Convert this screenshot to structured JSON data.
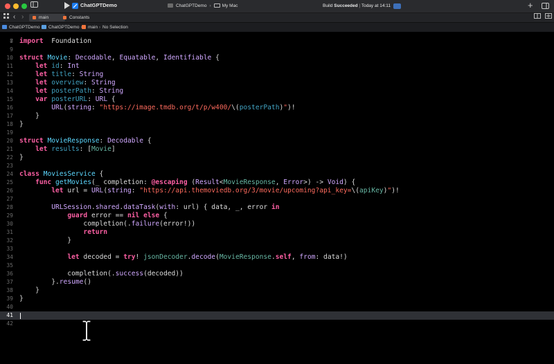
{
  "window": {
    "title": "ChatGPTDemo",
    "scheme": "ChatGPTDemo",
    "destination": "My Mac",
    "status_prefix": "Build",
    "status_bold": "Succeeded",
    "status_time": "Today at 14:11"
  },
  "tabs": [
    "main",
    "Constants"
  ],
  "breadcrumb": [
    "ChatGPTDemo",
    "ChatGPTDemo",
    "main",
    "No Selection"
  ],
  "code": {
    "partial_line_number": "7",
    "current_line": 41,
    "lines": [
      {
        "n": "8",
        "t": [
          [
            "kw",
            "import"
          ],
          [
            "",
            "  Foundation"
          ]
        ]
      },
      {
        "n": "9",
        "t": []
      },
      {
        "n": "10",
        "t": [
          [
            "kw",
            "struct"
          ],
          [
            "",
            " "
          ],
          [
            "ty",
            "Movie"
          ],
          [
            "",
            ": "
          ],
          [
            "lib",
            "Decodable"
          ],
          [
            "",
            ", "
          ],
          [
            "lib",
            "Equatable"
          ],
          [
            "",
            ", "
          ],
          [
            "lib",
            "Identifiable"
          ],
          [
            "",
            " {"
          ]
        ]
      },
      {
        "n": "11",
        "t": [
          [
            "",
            "    "
          ],
          [
            "kw",
            "let"
          ],
          [
            "",
            " "
          ],
          [
            "pr",
            "id"
          ],
          [
            "",
            ": "
          ],
          [
            "lib",
            "Int"
          ]
        ]
      },
      {
        "n": "12",
        "t": [
          [
            "",
            "    "
          ],
          [
            "kw",
            "let"
          ],
          [
            "",
            " "
          ],
          [
            "pr",
            "title"
          ],
          [
            "",
            ": "
          ],
          [
            "lib",
            "String"
          ]
        ]
      },
      {
        "n": "13",
        "t": [
          [
            "",
            "    "
          ],
          [
            "kw",
            "let"
          ],
          [
            "",
            " "
          ],
          [
            "pr",
            "overview"
          ],
          [
            "",
            ": "
          ],
          [
            "lib",
            "String"
          ]
        ]
      },
      {
        "n": "14",
        "t": [
          [
            "",
            "    "
          ],
          [
            "kw",
            "let"
          ],
          [
            "",
            " "
          ],
          [
            "pr",
            "posterPath"
          ],
          [
            "",
            ": "
          ],
          [
            "lib",
            "String"
          ]
        ]
      },
      {
        "n": "15",
        "t": [
          [
            "",
            "    "
          ],
          [
            "kw",
            "var"
          ],
          [
            "",
            " "
          ],
          [
            "pr",
            "posterURL"
          ],
          [
            "",
            ": "
          ],
          [
            "lib",
            "URL"
          ],
          [
            "",
            " {"
          ]
        ]
      },
      {
        "n": "16",
        "t": [
          [
            "",
            "        "
          ],
          [
            "lib",
            "URL"
          ],
          [
            "",
            "("
          ],
          [
            "lib",
            "string"
          ],
          [
            "",
            ": "
          ],
          [
            "st",
            "\"https://image.tmdb.org/t/p/w400/"
          ],
          [
            "",
            "\\("
          ],
          [
            "pr",
            "posterPath"
          ],
          [
            "",
            ")"
          ],
          [
            "st",
            "\""
          ],
          [
            "",
            ")!"
          ]
        ]
      },
      {
        "n": "17",
        "t": [
          [
            "",
            "    }"
          ]
        ]
      },
      {
        "n": "18",
        "t": [
          [
            "",
            "}"
          ]
        ]
      },
      {
        "n": "19",
        "t": []
      },
      {
        "n": "20",
        "t": [
          [
            "kw",
            "struct"
          ],
          [
            "",
            " "
          ],
          [
            "ty",
            "MovieResponse"
          ],
          [
            "",
            ": "
          ],
          [
            "lib",
            "Decodable"
          ],
          [
            "",
            " {"
          ]
        ]
      },
      {
        "n": "21",
        "t": [
          [
            "",
            "    "
          ],
          [
            "kw",
            "let"
          ],
          [
            "",
            " "
          ],
          [
            "pr",
            "results"
          ],
          [
            "",
            ": ["
          ],
          [
            "fn",
            "Movie"
          ],
          [
            "",
            "]"
          ]
        ]
      },
      {
        "n": "22",
        "t": [
          [
            "",
            "}"
          ]
        ]
      },
      {
        "n": "23",
        "t": []
      },
      {
        "n": "24",
        "t": [
          [
            "kw",
            "class"
          ],
          [
            "",
            " "
          ],
          [
            "ty",
            "MoviesService"
          ],
          [
            "",
            " {"
          ]
        ]
      },
      {
        "n": "25",
        "t": [
          [
            "",
            "    "
          ],
          [
            "kw",
            "func"
          ],
          [
            "",
            " "
          ],
          [
            "ty",
            "getMovies"
          ],
          [
            "",
            "(_ completion: "
          ],
          [
            "kw",
            "@escaping"
          ],
          [
            "",
            " ("
          ],
          [
            "lib",
            "Result"
          ],
          [
            "",
            "<"
          ],
          [
            "fn",
            "MovieResponse"
          ],
          [
            "",
            ", "
          ],
          [
            "lib",
            "Error"
          ],
          [
            "",
            ">) -> "
          ],
          [
            "lib",
            "Void"
          ],
          [
            "",
            ") {"
          ]
        ]
      },
      {
        "n": "26",
        "t": [
          [
            "",
            "        "
          ],
          [
            "kw",
            "let"
          ],
          [
            "",
            " url = "
          ],
          [
            "lib",
            "URL"
          ],
          [
            "",
            "("
          ],
          [
            "lib",
            "string"
          ],
          [
            "",
            ": "
          ],
          [
            "st",
            "\"https://api.themoviedb.org/3/movie/upcoming?api_key="
          ],
          [
            "",
            "\\("
          ],
          [
            "fn",
            "apiKey"
          ],
          [
            "",
            ")"
          ],
          [
            "st",
            "\""
          ],
          [
            "",
            ")!"
          ]
        ]
      },
      {
        "n": "27",
        "t": []
      },
      {
        "n": "28",
        "t": [
          [
            "",
            "        "
          ],
          [
            "lib",
            "URLSession"
          ],
          [
            "",
            "."
          ],
          [
            "lib",
            "shared"
          ],
          [
            "",
            "."
          ],
          [
            "lib",
            "dataTask"
          ],
          [
            "",
            "("
          ],
          [
            "lib",
            "with"
          ],
          [
            "",
            ": url) { data, _, error "
          ],
          [
            "kw",
            "in"
          ]
        ]
      },
      {
        "n": "29",
        "t": [
          [
            "",
            "            "
          ],
          [
            "kw",
            "guard"
          ],
          [
            "",
            " error == "
          ],
          [
            "kw",
            "nil"
          ],
          [
            "",
            " "
          ],
          [
            "kw",
            "else"
          ],
          [
            "",
            " {"
          ]
        ]
      },
      {
        "n": "30",
        "t": [
          [
            "",
            "                completion(."
          ],
          [
            "lib",
            "failure"
          ],
          [
            "",
            "(error!))"
          ]
        ]
      },
      {
        "n": "31",
        "t": [
          [
            "",
            "                "
          ],
          [
            "kw",
            "return"
          ]
        ]
      },
      {
        "n": "32",
        "t": [
          [
            "",
            "            }"
          ]
        ]
      },
      {
        "n": "33",
        "t": []
      },
      {
        "n": "34",
        "t": [
          [
            "",
            "            "
          ],
          [
            "kw",
            "let"
          ],
          [
            "",
            " decoded = "
          ],
          [
            "kw",
            "try"
          ],
          [
            "",
            "! "
          ],
          [
            "fn",
            "jsonDecoder"
          ],
          [
            "",
            "."
          ],
          [
            "lib",
            "decode"
          ],
          [
            "",
            "("
          ],
          [
            "fn",
            "MovieResponse"
          ],
          [
            "",
            "."
          ],
          [
            "kw",
            "self"
          ],
          [
            "",
            ", "
          ],
          [
            "lib",
            "from"
          ],
          [
            "",
            ": data!)"
          ]
        ]
      },
      {
        "n": "35",
        "t": []
      },
      {
        "n": "36",
        "t": [
          [
            "",
            "            completion(."
          ],
          [
            "lib",
            "success"
          ],
          [
            "",
            "(decoded))"
          ]
        ]
      },
      {
        "n": "37",
        "t": [
          [
            "",
            "        }."
          ],
          [
            "lib",
            "resume"
          ],
          [
            "",
            "()"
          ]
        ]
      },
      {
        "n": "38",
        "t": [
          [
            "",
            "    }"
          ]
        ]
      },
      {
        "n": "39",
        "t": [
          [
            "",
            "}"
          ]
        ]
      },
      {
        "n": "40",
        "t": []
      },
      {
        "n": "41",
        "t": []
      },
      {
        "n": "42",
        "t": []
      }
    ]
  },
  "colors": {
    "keyword": "#fc5fa3",
    "type_decl": "#5dd8ff",
    "property": "#41a1c0",
    "project_symbol": "#67b7a4",
    "string": "#fc6a5d",
    "library_symbol": "#d0a8ff",
    "current_line_bg": "#2f3136"
  },
  "icons": {
    "traffic_lights": [
      "close-icon",
      "minimize-icon",
      "zoom-icon"
    ],
    "sidebar_toggle": "sidebar-icon",
    "run": "play-icon",
    "app": "xcode-icon",
    "library": "plus-icon",
    "inspector": "inspector-icon",
    "pointer": "ibeam-cursor-icon"
  }
}
